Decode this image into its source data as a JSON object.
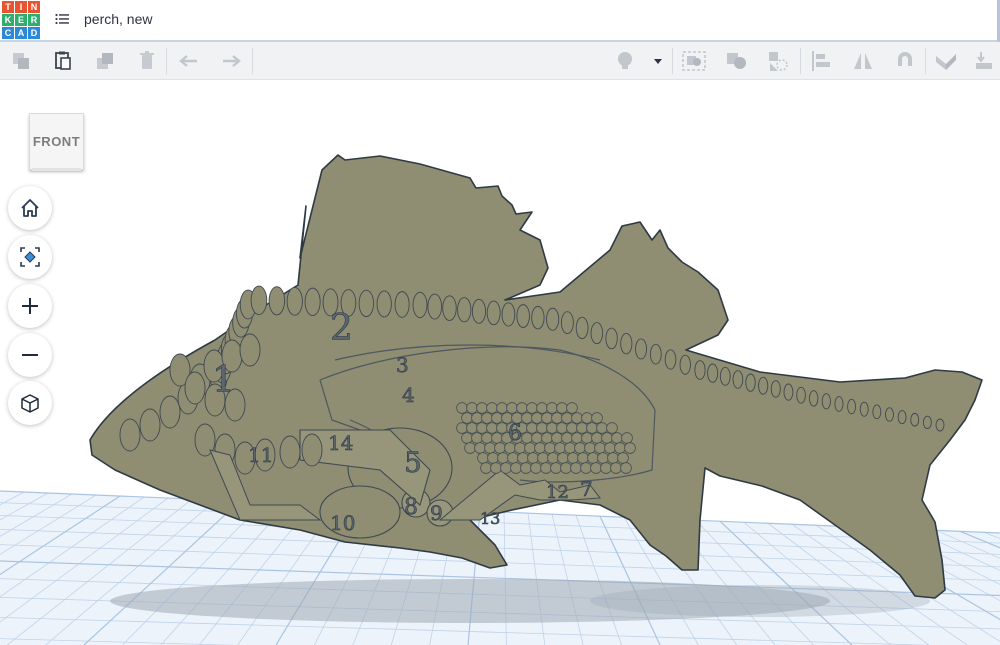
{
  "app": {
    "name": "Tinkercad",
    "logo_letters": [
      "T",
      "I",
      "N",
      "K",
      "E",
      "R",
      "C",
      "A",
      "D"
    ]
  },
  "header": {
    "project_title": "perch, new"
  },
  "toolbar": {
    "left_tools": [
      "copy-icon",
      "paste-icon",
      "duplicate-icon",
      "delete-icon",
      "undo-icon",
      "redo-icon"
    ],
    "right_tools": [
      "light-bulb-icon",
      "chevron-down-icon",
      "group-icon",
      "ungroup-icon",
      "align-icon",
      "mirror-icon",
      "magnet-icon",
      "workplane-icon",
      "ruler-icon",
      "import-icon"
    ]
  },
  "viewcube": {
    "face_label": "FRONT"
  },
  "nav_controls": [
    "home-view",
    "fit-view",
    "zoom-in",
    "zoom-out",
    "orthographic-toggle"
  ],
  "model": {
    "name": "perch",
    "fill_color": "#8f8d72",
    "outline_color": "#2e3a44",
    "part_labels": [
      "1",
      "2",
      "3",
      "4",
      "5",
      "6",
      "7",
      "8",
      "9",
      "10",
      "11",
      "12",
      "13",
      "14"
    ]
  },
  "colors": {
    "grid_line": "#bfd3ea",
    "grid_major": "#a9c4e2",
    "header_rule": "#c8d3e3"
  }
}
